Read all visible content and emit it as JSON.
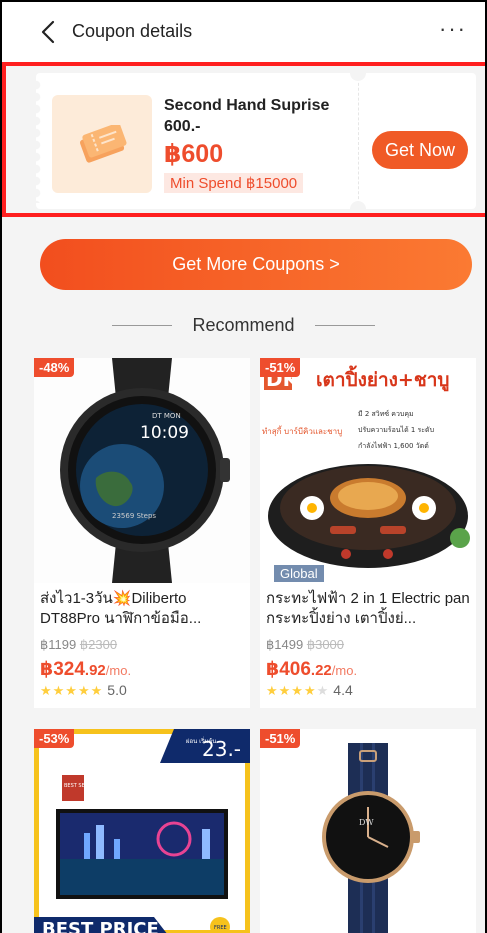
{
  "header": {
    "title": "Coupon details",
    "back_icon": "chevron-left-icon",
    "more_icon": "more-horizontal-icon",
    "more_glyph": "···"
  },
  "coupon": {
    "name": "Second Hand Suprise 600.-",
    "amount": "฿600",
    "min_spend": "Min Spend ฿15000",
    "button": "Get Now",
    "icon": "ticket-icon",
    "colors": {
      "accent": "#ee4d2d",
      "thumb_bg": "#fdebd9"
    }
  },
  "get_more": {
    "label": "Get More Coupons >"
  },
  "recommend": {
    "label": "Recommend"
  },
  "products": [
    {
      "discount": "-48%",
      "name": "ส่งไว1-3วัน💥Diliberto DT88Pro นาฬิกาข้อมือ...",
      "price": "฿1199",
      "old_price": "฿2300",
      "mo_big": "฿324",
      "mo_small": ".92",
      "mo_unit": "/mo.",
      "rating": "5.0",
      "stars": 5,
      "image_text": {
        "day": "DT MON",
        "time": "10:09",
        "steps": "23569 Steps"
      }
    },
    {
      "discount": "-51%",
      "name": "กระทะไฟฟ้า 2 in 1 Electric pan กระทะปิ้งย่าง เตาปิ้งย่...",
      "price": "฿1499",
      "old_price": "฿3000",
      "mo_big": "฿406",
      "mo_small": ".22",
      "mo_unit": "/mo.",
      "rating": "4.4",
      "stars": 4,
      "badge": "Global",
      "image_text": {
        "brand": "DK",
        "headline": "เตาปิ้งย่าง+ชาบู",
        "tag": "ทำสุกี้ บาร์บีคิวและชาบู",
        "f1": "มี 2 สวิทซ์ ควบคุม",
        "f2": "ปรับความร้อนได้ 1 ระดับ",
        "f3": "กำลังไฟฟ้า 1,600 วัตต์"
      }
    },
    {
      "discount": "-53%",
      "image_text": {
        "promo_small": "ผ่อน เริ่มต้น",
        "promo_big": "23.-",
        "best_price": "BEST PRICE",
        "seller": "BEST SELLER",
        "free": "FREE"
      }
    },
    {
      "discount": "-51%",
      "image_text": {
        "watch_brand": "DW"
      }
    }
  ]
}
